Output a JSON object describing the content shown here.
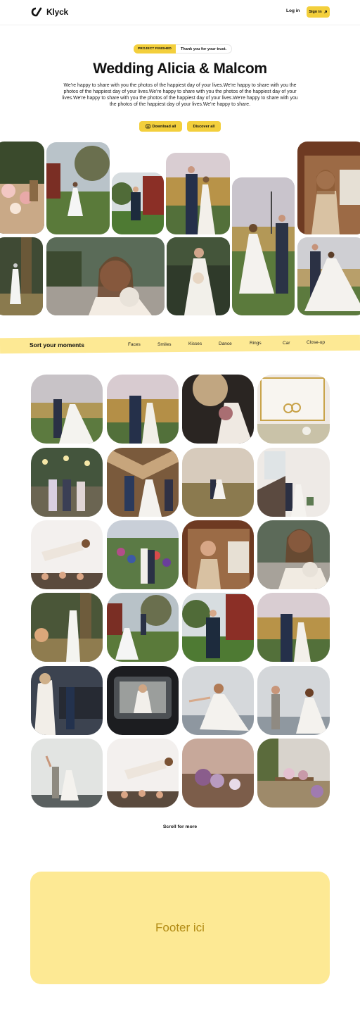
{
  "header": {
    "brand": "Klyck",
    "login": "Log in",
    "signin": "Sign in"
  },
  "hero": {
    "badge_tag": "PROJECT FINISHED",
    "badge_text": "Thank you for your trust.",
    "title": "Wedding Alicia & Malcom",
    "description": "We're happy to share with you the photos of the happiest day of your lives.We're happy to share with you the photos of the happiest day of your lives.We're happy to share with you the photos of the happiest day of your lives.We're happy to share with you the photos of the happiest day of your lives.We're happy to share with you the photos of the happiest day of your lives.We're happy to share.",
    "download_label": "Download all",
    "discover_label": "Discover all"
  },
  "sort": {
    "title": "Sort your moments",
    "chips": [
      "Faces",
      "Smiles",
      "Kisses",
      "Dance",
      "Rings",
      "Car",
      "Close-up"
    ]
  },
  "scroll_more": "Scroll for more",
  "footer": {
    "text": "Footer ici"
  },
  "colors": {
    "accent": "#f3cf3c",
    "band": "#fde994",
    "footer_text": "#b28b14"
  }
}
